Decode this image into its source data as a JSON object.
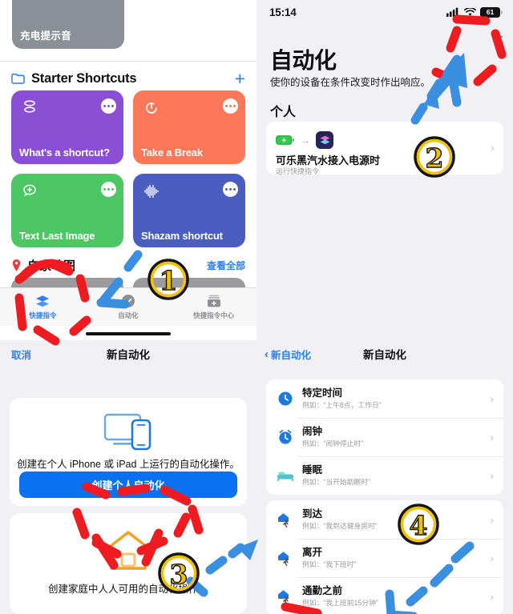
{
  "panels": {
    "shortcuts_home": {
      "grey_card_label": "充电提示音",
      "section": {
        "title": "Starter Shortcuts",
        "folder_icon": "folder-icon",
        "add_icon": "plus-icon"
      },
      "cards": [
        {
          "name": "What's a shortcut?",
          "color": "#8b4fd6",
          "icon": "layers-icon"
        },
        {
          "name": "Take a Break",
          "color": "#fc7858",
          "icon": "timer-icon"
        },
        {
          "name": "Text Last Image",
          "color": "#4cc764",
          "icon": "message-plus-icon"
        },
        {
          "name": "Shazam shortcut",
          "color": "#4b5ec0",
          "icon": "waveform-icon"
        }
      ],
      "map_section": {
        "title": "自家地图",
        "see_all": "查看全部",
        "icon": "map-pin-icon"
      },
      "tabs": [
        {
          "label": "快捷指令",
          "icon": "shortcuts-icon",
          "active": true
        },
        {
          "label": "自动化",
          "icon": "automation-icon",
          "active": false
        },
        {
          "label": "快捷指令中心",
          "icon": "gallery-icon",
          "active": false
        }
      ]
    },
    "automation_list": {
      "status_bar": {
        "time": "15:14",
        "battery": "61",
        "signal_icon": "cellular-icon",
        "wifi_icon": "wifi-icon"
      },
      "add_icon": "plus-icon",
      "title": "自动化",
      "subtitle": "使你的设备在条件改变时作出响应。",
      "section_label": "个人",
      "card": {
        "trigger_icon": "battery-charging-icon",
        "arrow_icon": "arrow-right-icon",
        "app_icon": "shortcuts-app-icon",
        "title": "可乐黑汽水接入电源时",
        "subtitle": "运行快捷指令",
        "chevron": "chevron-right-icon"
      }
    },
    "new_automation": {
      "cancel_label": "取消",
      "nav_title": "新自动化",
      "personal": {
        "icon": "devices-icon",
        "description": "创建在个人 iPhone 或 iPad 上运行的自动化操作。",
        "button_label": "创建个人自动化"
      },
      "home": {
        "icon": "home-icon",
        "description": "创建家庭中人人可用的自动化操作。"
      }
    },
    "trigger_picker": {
      "back_label": "新自动化",
      "back_icon": "chevron-left-icon",
      "nav_title": "新自动化",
      "groups": [
        {
          "items": [
            {
              "icon": "clock-icon",
              "title": "特定时间",
              "subtitle": "例如：“上午8点，工作日”",
              "chevron": "chevron-right-icon"
            },
            {
              "icon": "alarm-icon",
              "title": "闹钟",
              "subtitle": "例如：“闹钟停止时”",
              "chevron": "chevron-right-icon"
            },
            {
              "icon": "bed-icon",
              "title": "睡眠",
              "subtitle": "例如：“当开始助眠时”",
              "chevron": "chevron-right-icon"
            }
          ]
        },
        {
          "items": [
            {
              "icon": "arrive-icon",
              "title": "到达",
              "subtitle": "例如：“我到达健身房时”",
              "chevron": "chevron-right-icon"
            },
            {
              "icon": "leave-icon",
              "title": "离开",
              "subtitle": "例如：“我下班时”",
              "chevron": "chevron-right-icon"
            },
            {
              "icon": "commute-icon",
              "title": "通勤之前",
              "subtitle": "例如：“我上班前15分钟”",
              "chevron": "chevron-right-icon"
            }
          ]
        }
      ]
    }
  },
  "annotations": {
    "step_numbers": [
      "①",
      "②",
      "③",
      "④"
    ],
    "marker_red": "#ee1c21",
    "marker_blue": "#3b8fe0",
    "marker_gold": "#f2c200"
  },
  "colors": {
    "ios_blue": "#2f7ef2",
    "button_blue": "#0a72f0",
    "page_bg": "#f1f1f5",
    "card_white": "#ffffff",
    "secondary_text": "#9a9a9f"
  }
}
